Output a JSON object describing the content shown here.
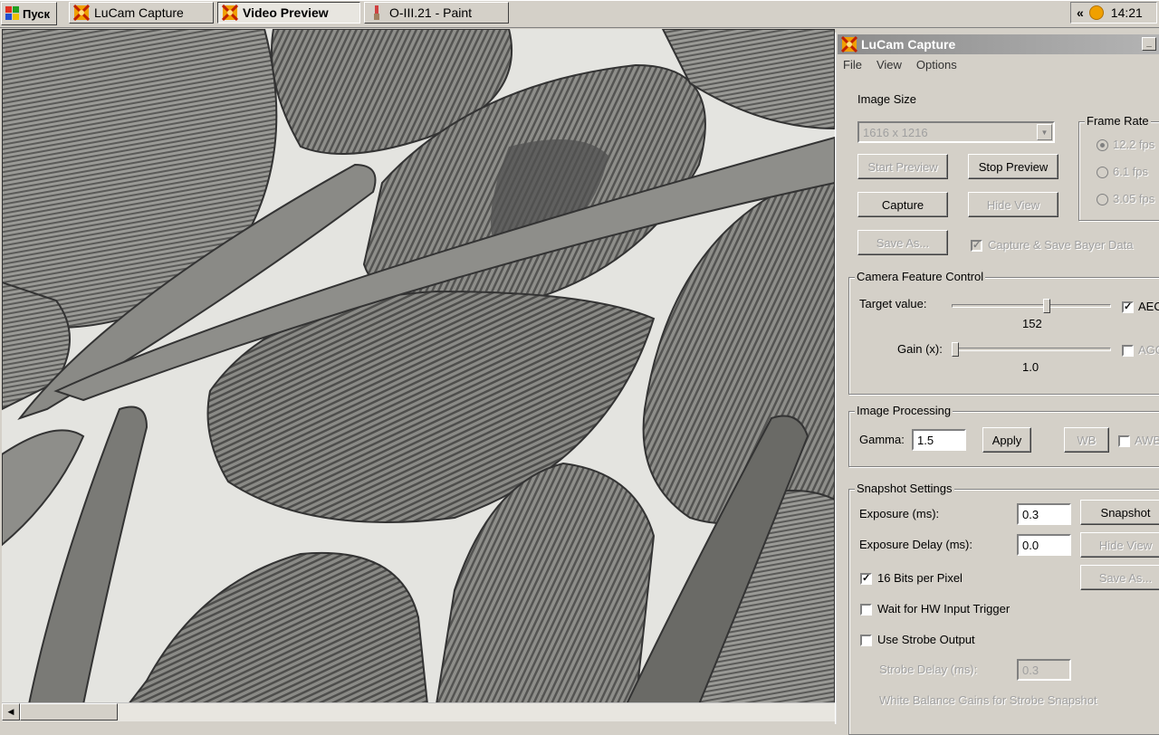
{
  "taskbar": {
    "start_label": "Пуск",
    "tasks": [
      {
        "label": "LuCam Capture",
        "icon": "lucam-icon"
      },
      {
        "label": "Video Preview",
        "icon": "lucam-icon"
      },
      {
        "label": "O-III.21 - Paint",
        "icon": "paint-icon"
      }
    ],
    "tray_chevron": "«",
    "clock": "14:21"
  },
  "preview": {
    "image_description_icon": "microscope-image"
  },
  "capture_window": {
    "title": "LuCam Capture",
    "minimize_label": "_",
    "menu": [
      "File",
      "View",
      "Options"
    ],
    "image_size": {
      "label": "Image Size",
      "selected": "1616 x 1216"
    },
    "buttons": {
      "start_preview": "Start Preview",
      "stop_preview": "Stop Preview",
      "capture": "Capture",
      "hide_view": "Hide View",
      "save_as": "Save As..."
    },
    "capture_bayer": {
      "label": "Capture & Save Bayer Data",
      "checked": true
    },
    "frame_rate": {
      "title": "Frame Rate",
      "options": [
        "12.2 fps",
        "6.1 fps",
        "3.05 fps"
      ],
      "selected": 0
    },
    "camera_feature": {
      "title": "Camera Feature Control",
      "target_label": "Target value:",
      "target_value": "152",
      "target_level": 0.6,
      "aec_label": "AEC",
      "aec_checked": true,
      "gain_label": "Gain (x):",
      "gain_value": "1.0",
      "gain_level": 0.0,
      "agc_label": "AGC",
      "agc_checked": false
    },
    "image_processing": {
      "title": "Image Processing",
      "gamma_label": "Gamma:",
      "gamma_value": "1.5",
      "apply_label": "Apply",
      "wb_label": "WB",
      "awb_label": "AWB"
    },
    "snapshot": {
      "title": "Snapshot Settings",
      "exposure_label": "Exposure (ms):",
      "exposure_value": "0.3",
      "delay_label": "Exposure Delay (ms):",
      "delay_value": "0.0",
      "snapshot_btn": "Snapshot",
      "hide_view_btn": "Hide View",
      "save_as_btn": "Save As...",
      "bits_label": "16 Bits per Pixel",
      "bits_checked": true,
      "hw_trigger_label": "Wait for HW Input Trigger",
      "strobe_label": "Use Strobe Output",
      "strobe_delay_label": "Strobe Delay (ms):",
      "strobe_delay_value": "0.3",
      "wb_gains_label": "White Balance Gains for Strobe Snapshot"
    }
  }
}
